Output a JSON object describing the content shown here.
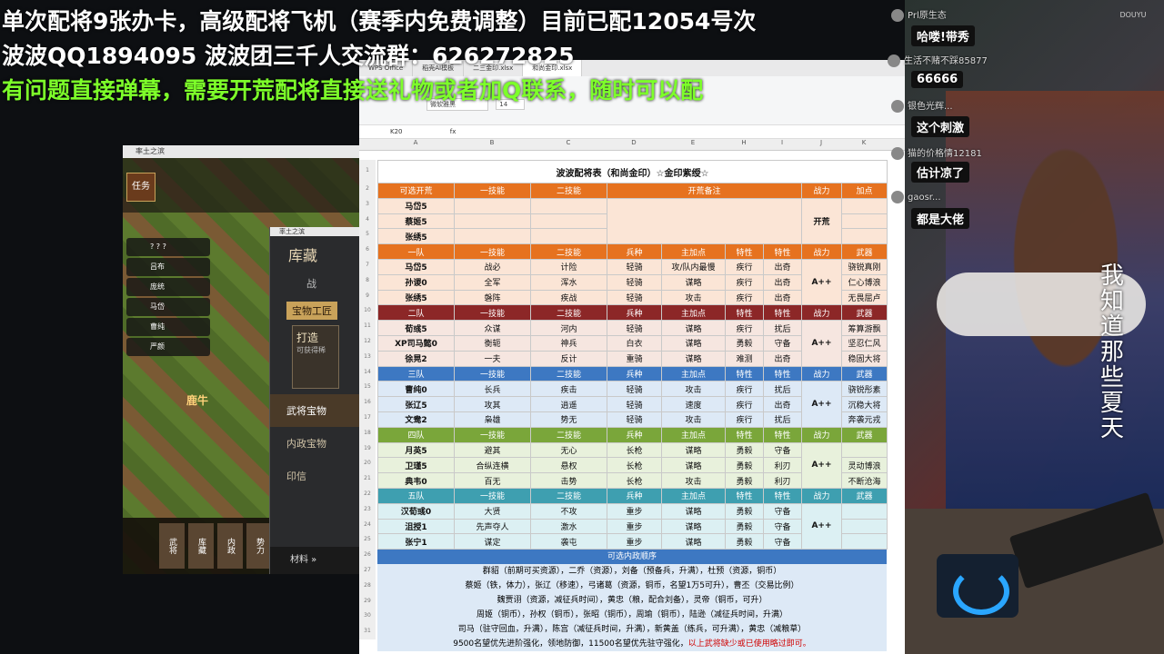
{
  "overlay": {
    "line1": "单次配将9张办卡，高级配将飞机（赛季内免费调整）目前已配12054号次",
    "line2": "波波QQ1894095  波波团三千人交流群：626272825",
    "line3": "有问题直接弹幕，需要开荒配将直接送礼物或者加Q联系，随时可以配"
  },
  "game": {
    "window_title": "率土之滨",
    "task": "任务",
    "sidebar": [
      "? ? ?",
      "吕布",
      "庞统",
      "马岱",
      "曹纯",
      "严颜"
    ],
    "city": "鹿牛",
    "bottom": [
      "武将",
      "库藏",
      "内政",
      "势力"
    ]
  },
  "treasure": {
    "window_title": "率土之滨",
    "title": "库藏",
    "tab1": "战",
    "workshop": "宝物工匠",
    "forge": "打造",
    "forge_sub": "可获得稀",
    "menu": [
      "武将宝物",
      "内政宝物",
      "印信"
    ],
    "materials": "材料 »"
  },
  "wps": {
    "tabs": [
      "WPS Office",
      "稻壳AI模板",
      "二三金印.xlsx",
      "和尚金印.xlsx"
    ],
    "font_name": "微软雅黑",
    "font_size": "14",
    "cell_ref": "K20",
    "fx": "fx",
    "col_letters": [
      "A",
      "B",
      "C",
      "D",
      "E",
      "H",
      "I",
      "J",
      "K"
    ],
    "title": "波波配将表（和尚金印）☆金印紫绶☆",
    "header_open": [
      "可选开荒",
      "一技能",
      "二技能",
      "开荒备注",
      "战力",
      "加点"
    ],
    "open_rows": [
      "马岱5",
      "蔡姬5",
      "张绣5"
    ],
    "open_note": "开荒",
    "header_cols": [
      "一技能",
      "二技能",
      "兵种",
      "主加点",
      "特性",
      "特性",
      "战力",
      "武器"
    ],
    "teams": [
      {
        "name": "一队",
        "power": "A++",
        "rows": [
          [
            "马岱5",
            "战必",
            "计险",
            "轻骑",
            "攻/队内最慢",
            "疾行",
            "出奇",
            "骁锐真刚"
          ],
          [
            "孙谡0",
            "全军",
            "浑水",
            "轻骑",
            "谋略",
            "疾行",
            "出奇",
            "仁心博浪"
          ],
          [
            "张绣5",
            "磐阵",
            "疾战",
            "轻骑",
            "攻击",
            "疾行",
            "出奇",
            "无畏屈卢"
          ]
        ]
      },
      {
        "name": "二队",
        "power": "A++",
        "rows": [
          [
            "荀彧5",
            "众谋",
            "河内",
            "轻骑",
            "谋略",
            "疾行",
            "扰后",
            "筹算游飘"
          ],
          [
            "XP司马懿0",
            "衡轭",
            "神兵",
            "白衣",
            "谋略",
            "勇毅",
            "守备",
            "坚忍仁风"
          ],
          [
            "徐晃2",
            "一夫",
            "反计",
            "重骑",
            "谋略",
            "难测",
            "出奇",
            "稳固大将"
          ]
        ]
      },
      {
        "name": "三队",
        "power": "A++",
        "rows": [
          [
            "曹纯0",
            "长兵",
            "疾击",
            "轻骑",
            "攻击",
            "疾行",
            "扰后",
            "骁锐彤素"
          ],
          [
            "张辽5",
            "攻其",
            "逍遥",
            "轻骑",
            "速度",
            "疾行",
            "出奇",
            "沉稳大将"
          ],
          [
            "文鸯2",
            "枭雄",
            "势无",
            "轻骑",
            "攻击",
            "疾行",
            "扰后",
            "奔袭元戎"
          ]
        ]
      },
      {
        "name": "四队",
        "power": "A++",
        "rows": [
          [
            "月英5",
            "避其",
            "无心",
            "长枪",
            "谋略",
            "勇毅",
            "守备",
            ""
          ],
          [
            "卫瑾5",
            "合纵连横",
            "悬权",
            "长枪",
            "谋略",
            "勇毅",
            "利刃",
            "灵动博浪"
          ],
          [
            "典韦0",
            "百无",
            "击势",
            "长枪",
            "攻击",
            "勇毅",
            "利刃",
            "不断沧海"
          ]
        ]
      },
      {
        "name": "五队",
        "power": "A++",
        "rows": [
          [
            "汉荀彧0",
            "大贤",
            "不攻",
            "重步",
            "谋略",
            "勇毅",
            "守备",
            ""
          ],
          [
            "沮授1",
            "先声夺人",
            "激水",
            "重步",
            "谋略",
            "勇毅",
            "守备",
            ""
          ],
          [
            "张宁1",
            "谋定",
            "袭屯",
            "重步",
            "谋略",
            "勇毅",
            "守备",
            ""
          ]
        ]
      }
    ],
    "order_title": "可选内政顺序",
    "order_lines": [
      "群貂（前期可买资源），二乔（资源），刘备（预备兵，升满），杜预（资源，铜币）",
      "蔡姬（铁，体力），张辽（移速），弓诸葛（资源，铜币，名望1万5可升），曹丕（交易比例）",
      "魏贾诩（资源，减征兵时间），黄忠（粮，配合刘备），灵帝（铜币，可升）",
      "周姬（铜币），孙权（铜币），张昭（铜币），周瑜（铜币），陆逊（减征兵时间，升满）",
      "司马（驻守回血，升满），陈宫（减征兵时间，升满），新黄盖（练兵，可升满），黄忠（减粮草）"
    ],
    "last_line_a": "9500名望优先进阶强化，领地防御，11500名望优先驻守强化，",
    "last_line_b": "以上武将缺少或已使用略过即可。",
    "row_numbers": [
      "1",
      "2",
      "3",
      "4",
      "5",
      "6",
      "7",
      "8",
      "9",
      "10",
      "11",
      "12",
      "13",
      "14",
      "15",
      "16",
      "17",
      "18",
      "19",
      "20",
      "21",
      "22",
      "23",
      "24",
      "25",
      "26",
      "27",
      "28",
      "29",
      "30",
      "31"
    ]
  },
  "chat": {
    "platform": "DOUYU",
    "messages": [
      {
        "user": "Prl原生态",
        "text": "",
        "bubble": "哈喽!带秀"
      },
      {
        "user": "生活不赌不踩85877",
        "text": "",
        "bubble": "66666"
      },
      {
        "user": "银色光辉...",
        "text": "",
        "bubble": "这个刺激"
      },
      {
        "user": "猫的价格情12181",
        "text": "",
        "bubble": "估计凉了"
      },
      {
        "user": "gaosr...",
        "text": "",
        "bubble": "都是大佬"
      }
    ],
    "vertical_text": "我知道那些夏天"
  }
}
